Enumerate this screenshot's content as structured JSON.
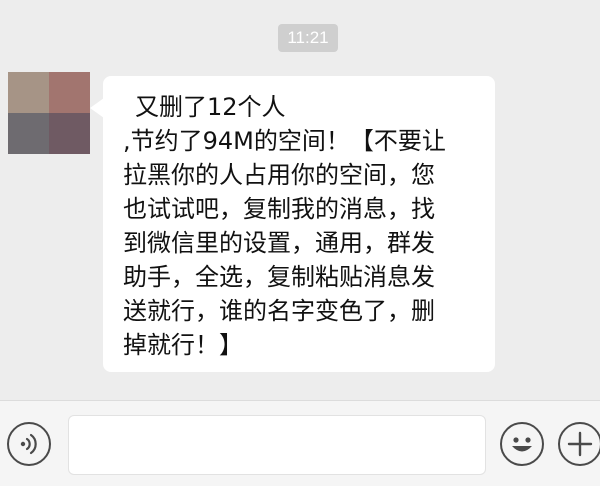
{
  "status": {
    "time": "11:21"
  },
  "message": {
    "lines": [
      "又删了12个人",
      ",节约了94M的空间！【不要让",
      "拉黑你的人占用你的空间，您",
      "也试试吧，复制我的消息，找",
      "到微信里的设置，通用，群发",
      "助手，全选，复制粘贴消息发",
      "送就行，谁的名字变色了，删",
      "掉就行！】"
    ]
  },
  "avatar": {
    "colors": [
      "#a69486",
      "#a2756f",
      "#6e6b70",
      "#6f5a63"
    ]
  },
  "input_bar": {
    "voice_icon": "voice-icon",
    "emoji_icon": "emoji-icon",
    "plus_icon": "plus-icon"
  },
  "colors": {
    "background": "#ededed",
    "bubble": "#ffffff",
    "time_pill": "#cfcfcf"
  }
}
